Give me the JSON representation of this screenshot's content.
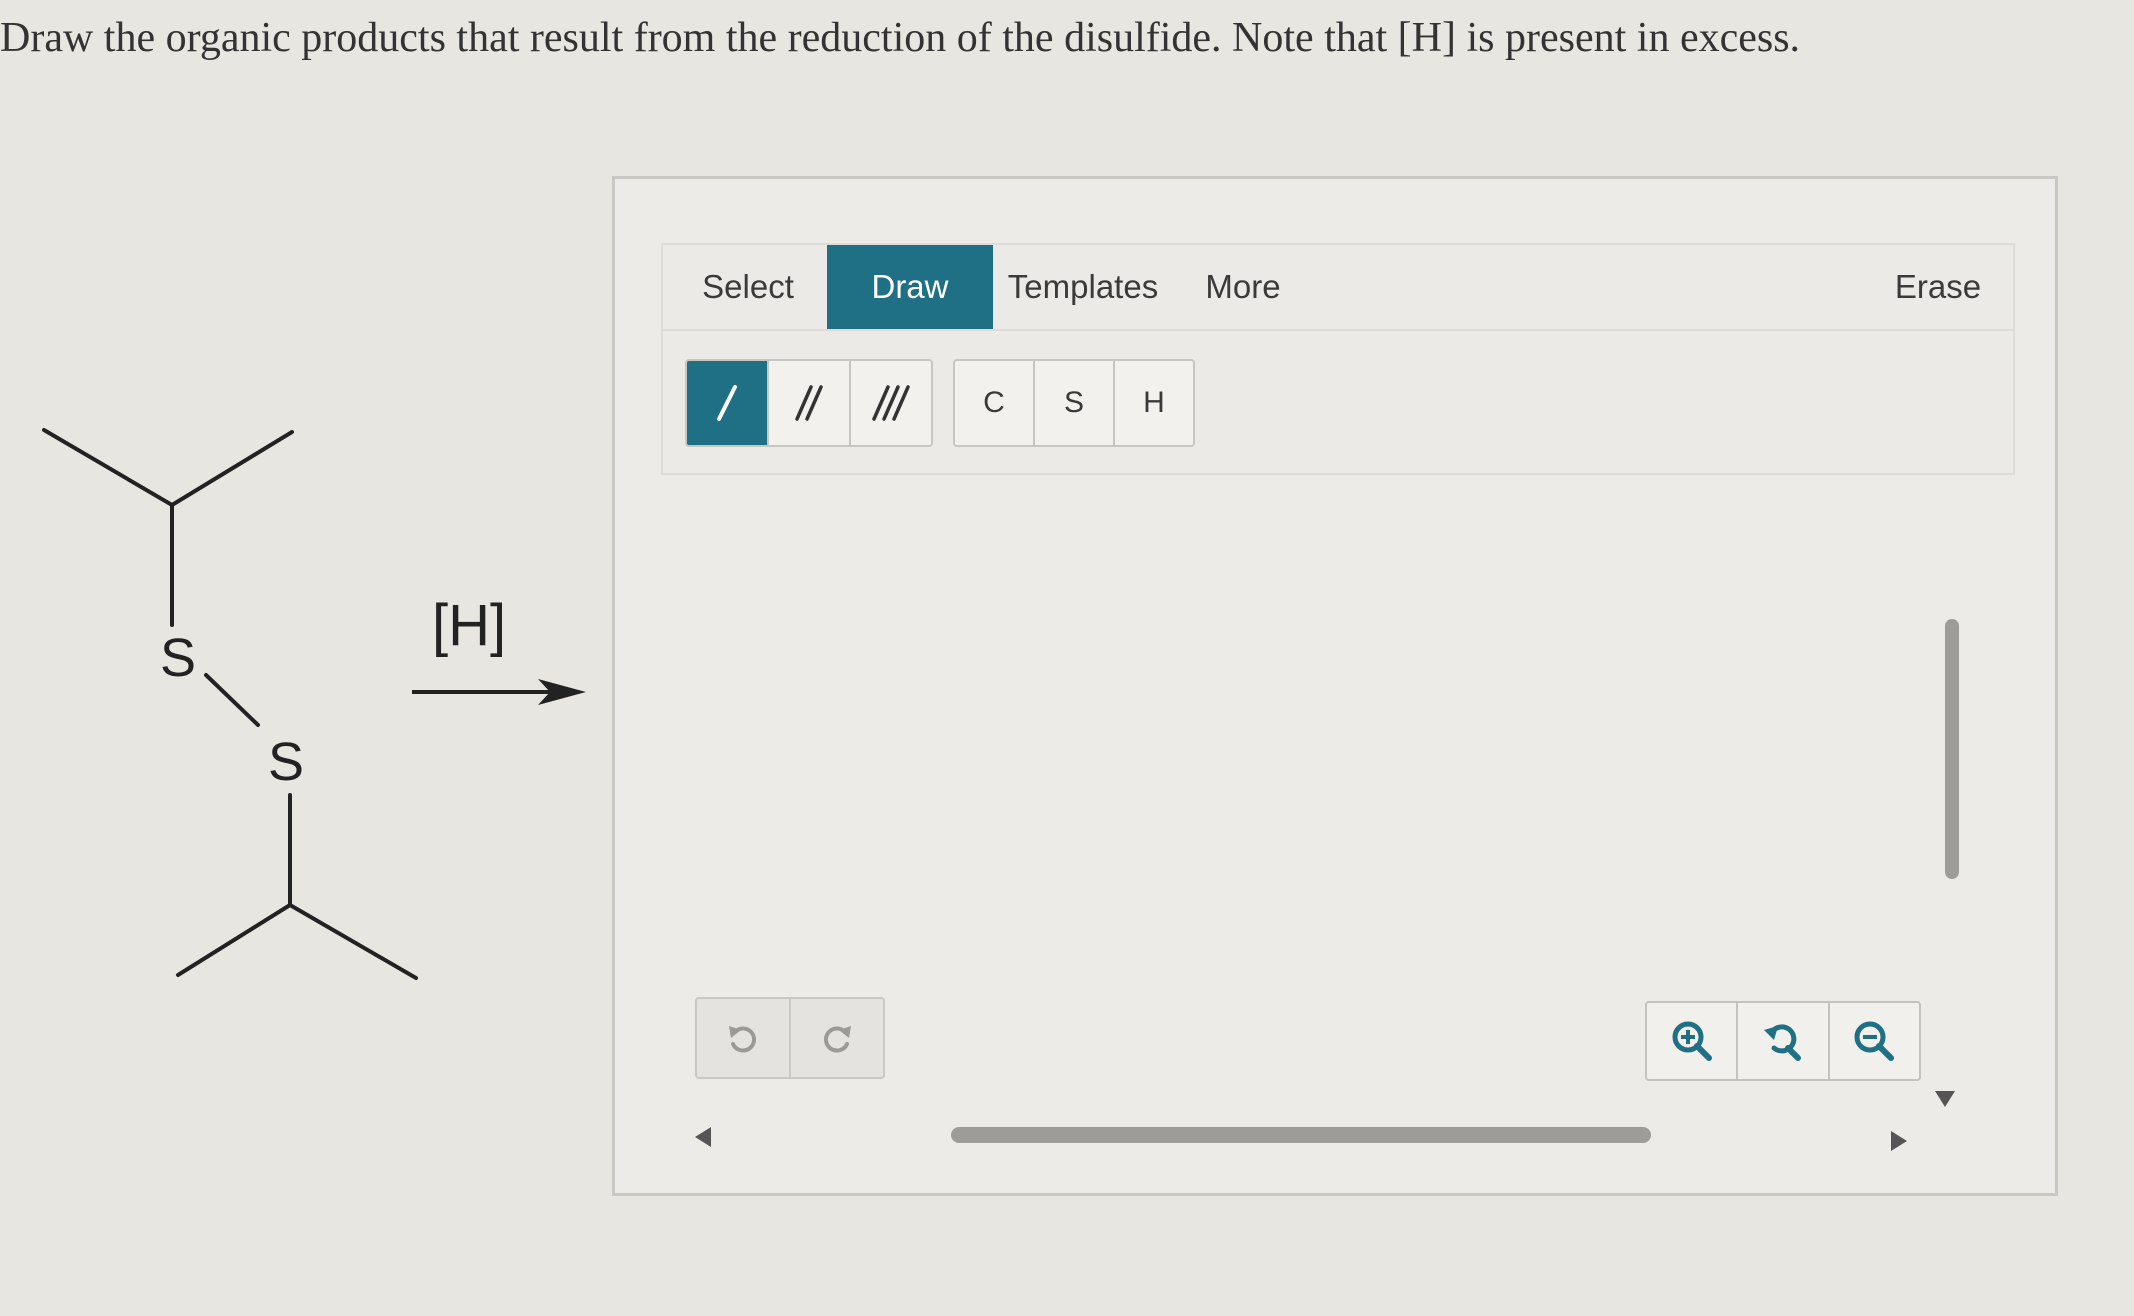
{
  "question": {
    "text": "Draw the organic products that result from the reduction of the disulfide. Note that [H] is present in excess."
  },
  "reaction": {
    "reagent": "[H]",
    "atoms": [
      "S",
      "S"
    ]
  },
  "editor": {
    "tabs": [
      {
        "label": "Select",
        "active": false
      },
      {
        "label": "Draw",
        "active": true
      },
      {
        "label": "Templates",
        "active": false
      },
      {
        "label": "More",
        "active": false
      },
      {
        "label": "Erase",
        "active": false
      }
    ],
    "bond_tools": [
      {
        "name": "single-bond",
        "active": true
      },
      {
        "name": "double-bond",
        "active": false
      },
      {
        "name": "triple-bond",
        "active": false
      }
    ],
    "atom_tools": [
      "C",
      "S",
      "H"
    ],
    "history_icons": [
      "undo-icon",
      "redo-icon"
    ],
    "zoom_icons": [
      "zoom-in-icon",
      "reset-zoom-icon",
      "zoom-out-icon"
    ]
  },
  "colors": {
    "accent": "#1f6f85",
    "background": "#e7e6e1",
    "border": "#c9c8c3"
  }
}
